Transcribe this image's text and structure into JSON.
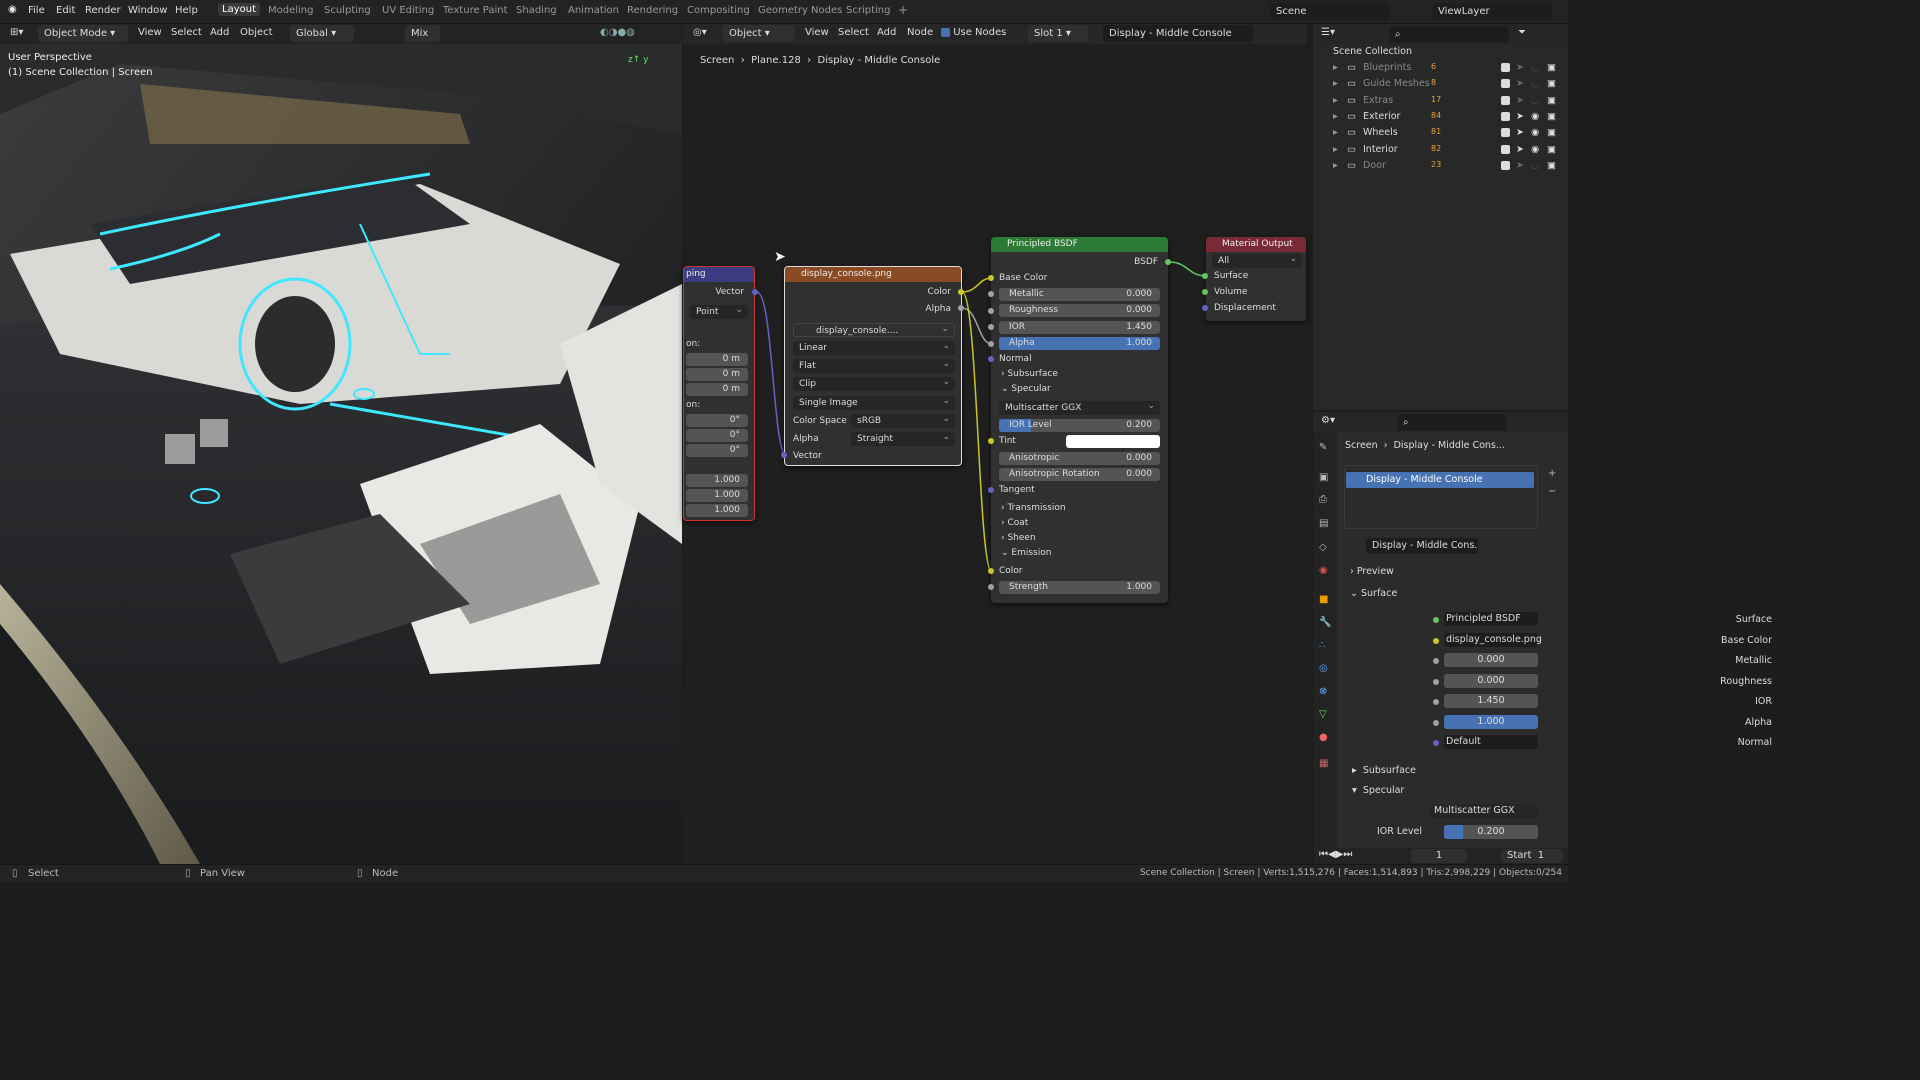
{
  "menu": {
    "file": "File",
    "edit": "Edit",
    "render": "Render",
    "window": "Window",
    "help": "Help"
  },
  "workspaces": [
    "Layout",
    "Modeling",
    "Sculpting",
    "UV Editing",
    "Texture Paint",
    "Shading",
    "Animation",
    "Rendering",
    "Compositing",
    "Geometry Nodes",
    "Scripting",
    "+"
  ],
  "scene": {
    "label": "Scene",
    "viewlayer": "ViewLayer"
  },
  "viewport": {
    "mode": "Object Mode",
    "view": "View",
    "select": "Select",
    "add": "Add",
    "object": "Object",
    "orientation": "Global",
    "snap": "Mix",
    "overlay_title": "User Perspective",
    "overlay_sub": "(1) Scene Collection | Screen"
  },
  "node_editor": {
    "type": "Object",
    "view": "View",
    "select": "Select",
    "add": "Add",
    "node": "Node",
    "use_nodes": "Use Nodes",
    "slot": "Slot 1",
    "material": "Display - Middle Console",
    "breadcrumb": [
      "Screen",
      "Plane.128",
      "Display - Middle Console"
    ]
  },
  "mapping_node": {
    "title": "ping",
    "vector": "Vector",
    "type": "Point",
    "loc_label": "on:",
    "rot_label": "on:",
    "loc": [
      "0 m",
      "0 m",
      "0 m"
    ],
    "rot": [
      "0°",
      "0°",
      "0°"
    ],
    "scale": [
      "1.000",
      "1.000",
      "1.000"
    ]
  },
  "image_node": {
    "title": "display_console.png",
    "color": "Color",
    "alpha": "Alpha",
    "image": "display_console....",
    "interp": "Linear",
    "proj": "Flat",
    "ext": "Clip",
    "source": "Single Image",
    "cs_label": "Color Space",
    "cs": "sRGB",
    "alpha_label": "Alpha",
    "alpha_mode": "Straight",
    "vector": "Vector"
  },
  "bsdf_node": {
    "title": "Principled BSDF",
    "bsdf": "BSDF",
    "base_color": "Base Color",
    "metallic": [
      "Metallic",
      "0.000"
    ],
    "roughness": [
      "Roughness",
      "0.000"
    ],
    "ior": [
      "IOR",
      "1.450"
    ],
    "alpha": [
      "Alpha",
      "1.000"
    ],
    "normal": "Normal",
    "subsurface": "Subsurface",
    "specular": "Specular",
    "distribution": "Multiscatter GGX",
    "ior_level": [
      "IOR Level",
      "0.200"
    ],
    "tint": "Tint",
    "aniso": [
      "Anisotropic",
      "0.000"
    ],
    "aniso_rot": [
      "Anisotropic Rotation",
      "0.000"
    ],
    "tangent": "Tangent",
    "transmission": "Transmission",
    "coat": "Coat",
    "sheen": "Sheen",
    "emission": "Emission",
    "em_color": "Color",
    "strength": [
      "Strength",
      "1.000"
    ]
  },
  "output_node": {
    "title": "Material Output",
    "target": "All",
    "surface": "Surface",
    "volume": "Volume",
    "displacement": "Displacement"
  },
  "outliner": {
    "root": "Scene Collection",
    "items": [
      {
        "name": "Blueprints",
        "count": "6",
        "visible": false
      },
      {
        "name": "Guide Meshes",
        "count": "8",
        "visible": false
      },
      {
        "name": "Extras",
        "count": "17",
        "visible": false
      },
      {
        "name": "Exterior",
        "count": "84",
        "visible": true
      },
      {
        "name": "Wheels",
        "count": "81",
        "visible": true
      },
      {
        "name": "Interior",
        "count": "82",
        "visible": true
      },
      {
        "name": "Door",
        "count": "23",
        "visible": false
      }
    ]
  },
  "properties": {
    "breadcrumb": [
      "Screen",
      "Display - Middle Cons..."
    ],
    "slot": "Display - Middle Console",
    "material": "Display - Middle Cons...",
    "preview": "Preview",
    "surface_panel": "Surface",
    "rows": [
      {
        "label": "Surface",
        "value": "Principled BSDF",
        "kind": "link"
      },
      {
        "label": "Base Color",
        "value": "display_console.png",
        "kind": "link"
      },
      {
        "label": "Metallic",
        "value": "0.000",
        "kind": "num"
      },
      {
        "label": "Roughness",
        "value": "0.000",
        "kind": "num"
      },
      {
        "label": "IOR",
        "value": "1.450",
        "kind": "num"
      },
      {
        "label": "Alpha",
        "value": "1.000",
        "kind": "blue"
      },
      {
        "label": "Normal",
        "value": "Default",
        "kind": "link"
      }
    ],
    "subsurface": "Subsurface",
    "specular": "Specular",
    "distribution": "Multiscatter GGX",
    "ior_level": [
      "IOR Level",
      "0.200"
    ]
  },
  "timeline": {
    "frame": "1",
    "start_label": "Start",
    "start": "1"
  },
  "status": {
    "select": "Select",
    "pan": "Pan View",
    "node": "Node",
    "stats": "Scene Collection | Screen | Verts:1,515,276 | Faces:1,514,893 | Tris:2,998,229 | Objects:0/254"
  }
}
